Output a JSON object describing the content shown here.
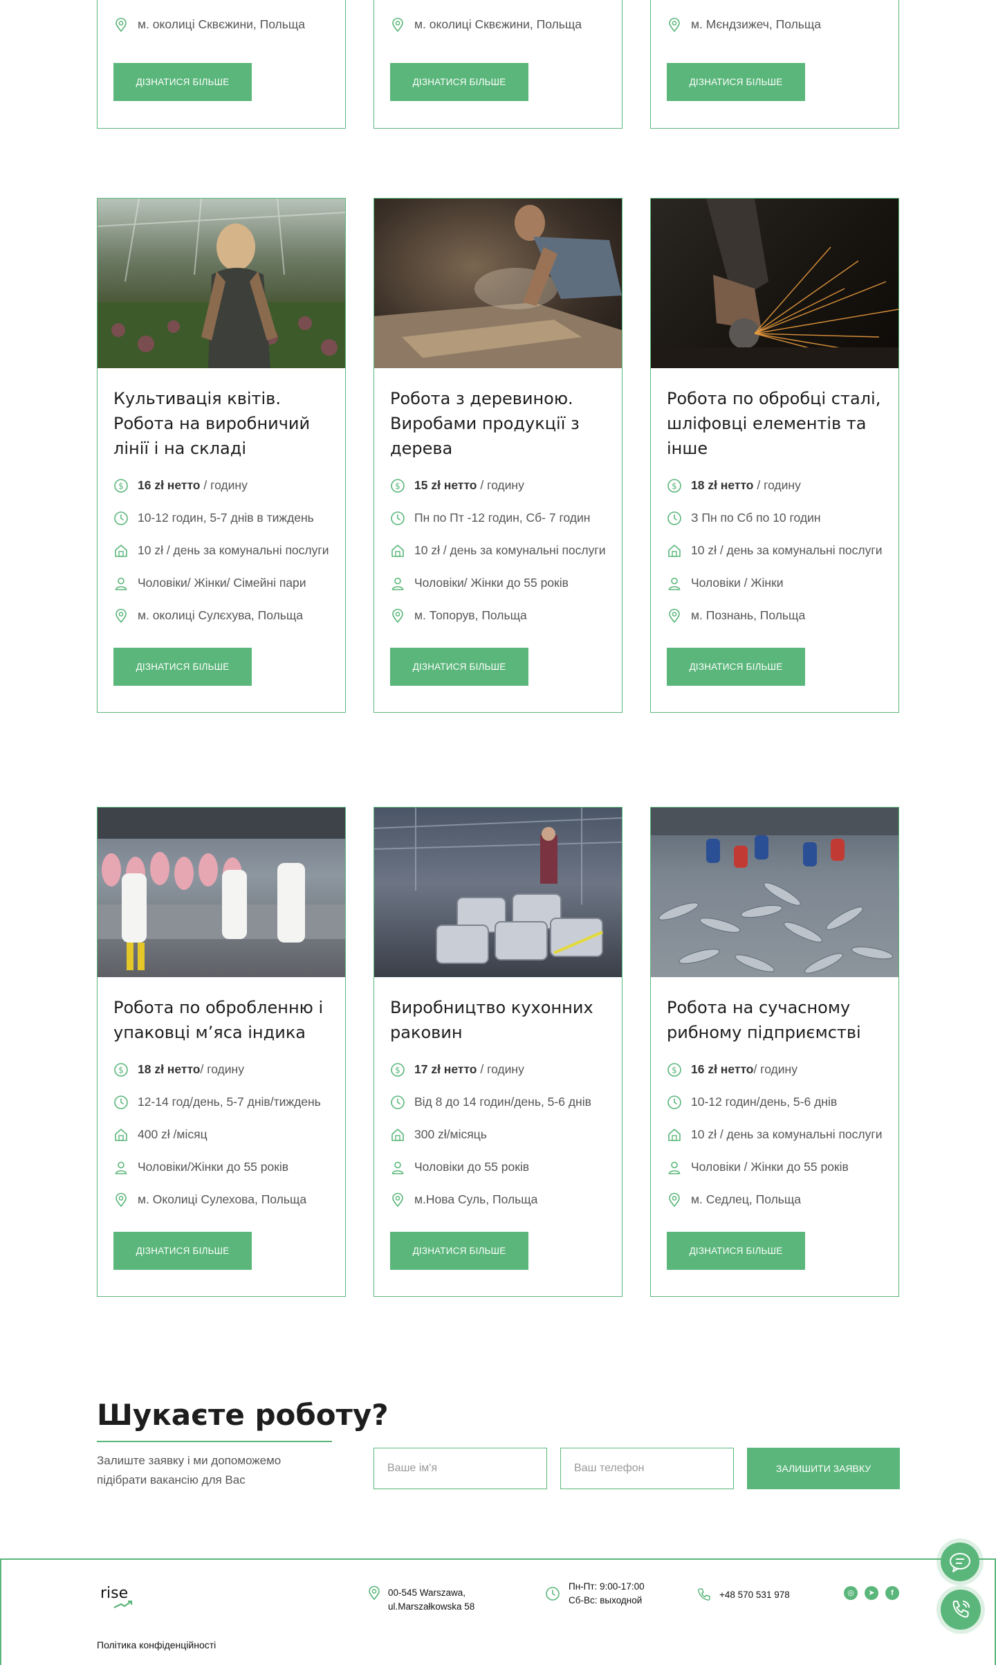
{
  "accent": "#5ab67a",
  "top_cards": [
    {
      "location": "м. околиці Сквєжини, Польща",
      "button": "ДІЗНАТИСЯ БІЛЬШЕ"
    },
    {
      "location": "м. околиці Сквєжини, Польща",
      "button": "ДІЗНАТИСЯ БІЛЬШЕ"
    },
    {
      "location": "м. Мєндзижеч, Польща",
      "button": "ДІЗНАТИСЯ БІЛЬШЕ"
    }
  ],
  "cards": [
    {
      "image": "woman-in-greenhouse-photo",
      "title": "Культивація квітів. Робота на виробничий лінії і на складі",
      "salary_bold": "16 zł нетто",
      "salary_rest": " / годину",
      "hours": "10-12 годин, 5-7 днів в тиждень",
      "housing": "10 zł / день за комунальні послуги",
      "people": "Чоловіки/ Жінки/ Сімейні пари",
      "location": "м. околиці Сулєхува, Польща",
      "button": "ДІЗНАТИСЯ БІЛЬШЕ"
    },
    {
      "image": "woodworker-photo",
      "title": "Робота з деревиною. Виробами продукції з дерева",
      "salary_bold": "15 zł нетто",
      "salary_rest": " / годину",
      "hours": "Пн по Пт -12 годин, Сб- 7 годин",
      "housing": "10 zł / день за комунальні послуги",
      "people": "Чоловіки/ Жінки до 55 років",
      "location": "м. Топорув, Польща",
      "button": "ДІЗНАТИСЯ БІЛЬШЕ"
    },
    {
      "image": "steel-grinding-photo",
      "title": "Робота по обробці сталі, шліфовці елементів та інше",
      "salary_bold": "18 zł нетто",
      "salary_rest": " / годину",
      "hours": "З Пн по Сб по 10 годин",
      "housing": "10 zł / день за комунальні послуги",
      "people": "Чоловіки / Жінки",
      "location": "м. Познань, Польща",
      "button": "ДІЗНАТИСЯ БІЛЬШЕ"
    },
    {
      "image": "turkey-processing-photo",
      "title": "Робота по обробленню і упаковці м’яса індика",
      "salary_bold": "18 zł нетто",
      "salary_rest": "/ годину",
      "hours": "12-14 год/день, 5-7 днів/тиждень",
      "housing": "400 zł /місяц",
      "people": "Чоловіки/Жінки до 55 років",
      "location": "м. Околиці Сулехова, Польща",
      "button": "ДІЗНАТИСЯ БІЛЬШЕ"
    },
    {
      "image": "kitchen-sinks-factory-photo",
      "title": "Виробництво кухонних раковин",
      "salary_bold": "17 zł нетто",
      "salary_rest": " / годину",
      "hours": "Від 8 до 14 годин/день, 5-6 днів",
      "housing": "300 zł/місяць",
      "people": "Чоловіки до 55 років",
      "location": "м.Нова Суль, Польща",
      "button": "ДІЗНАТИСЯ БІЛЬШЕ"
    },
    {
      "image": "fish-processing-photo",
      "title": "Робота на сучасному рибному підприємстві",
      "salary_bold": "16 zł нетто",
      "salary_rest": "/ годину",
      "hours": "10-12 годин/день, 5-6 днів",
      "housing": "10 zł / день за комунальні послуги",
      "people": "Чоловіки / Жінки до 55 років",
      "location": "м. Седлец, Польща",
      "button": "ДІЗНАТИСЯ БІЛЬШЕ"
    }
  ],
  "cta": {
    "title": "Шукаєте роботу?",
    "text": "Залиште заявку і ми допоможемо підібрати вакансію для Вас",
    "name_placeholder": "Ваше ім'я",
    "phone_placeholder": "Ваш телефон",
    "submit": "ЗАЛИШИТИ ЗАЯВКУ"
  },
  "footer": {
    "logo": "rise",
    "address_line1": "00-545 Warszawa,",
    "address_line2": "ul.Marszałkowska 58",
    "hours_line1": "Пн-Пт: 9:00-17:00",
    "hours_line2": "Сб-Вс: выходной",
    "phone": "+48 570 531 978",
    "policy": "Політика конфіденційності",
    "socials": [
      "instagram-icon",
      "telegram-icon",
      "facebook-icon"
    ]
  }
}
